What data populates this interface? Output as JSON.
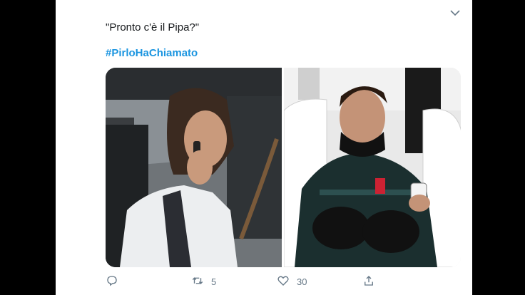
{
  "tweet": {
    "text": "\"Pronto c'è il Pipa?\"",
    "hashtag": "#PirloHaChiamato",
    "media": [
      {
        "icon": "photo-car-phone-call"
      },
      {
        "icon": "photo-stadium-bench-phone"
      }
    ],
    "actions": {
      "reply_count": "",
      "retweet_count": "5",
      "like_count": "30"
    }
  },
  "colors": {
    "hashtag": "#1b95e0",
    "text": "#14171a",
    "muted": "#657786"
  }
}
